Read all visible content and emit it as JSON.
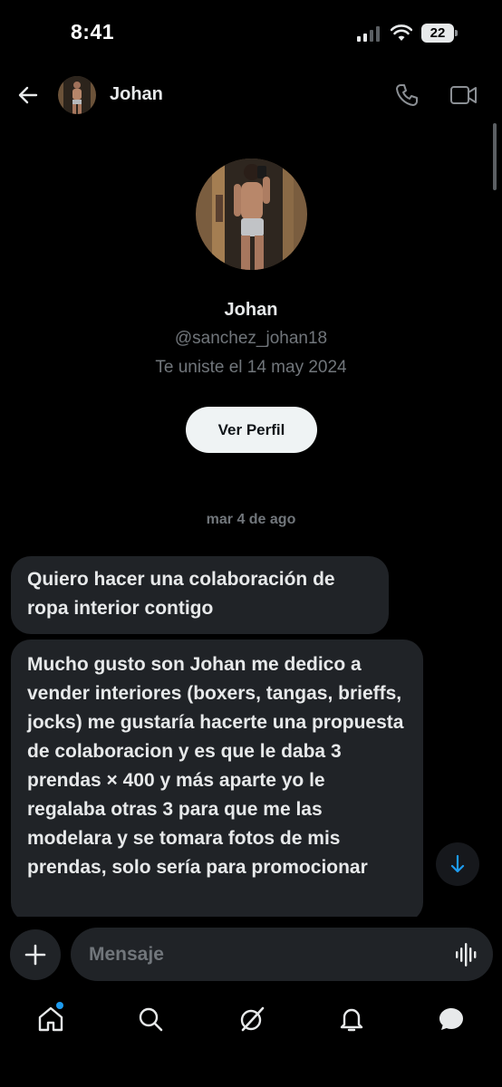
{
  "status_bar": {
    "time": "8:41",
    "battery": "22"
  },
  "header": {
    "name": "Johan",
    "icons": [
      "back-arrow-icon",
      "phone-icon",
      "video-camera-icon"
    ]
  },
  "profile": {
    "name": "Johan",
    "handle": "@sanchez_johan18",
    "joined": "Te uniste el 14 may 2024",
    "view_profile_label": "Ver Perfil"
  },
  "conversation": {
    "date_separator": "mar 4 de ago",
    "messages": [
      {
        "text": "Quiero hacer una colaboración de ropa interior contigo"
      },
      {
        "text": "Mucho gusto son Johan me dedico  a vender interiores (boxers, tangas, brieffs, jocks) me gustaría hacerte una propuesta de colaboracion y es que le daba 3 prendas × 400 y más aparte yo le regalaba otras 3 para que me las modelara y se tomara fotos de mis prendas, solo sería para promocionar"
      }
    ]
  },
  "composer": {
    "placeholder": "Mensaje"
  },
  "bottom_nav": {
    "items": [
      "home-icon",
      "search-icon",
      "grok-icon",
      "notifications-bell-icon",
      "messages-icon"
    ]
  },
  "colors": {
    "background": "#000000",
    "bubble": "#202327",
    "text": "#e7e9ea",
    "muted": "#71767b",
    "accent": "#1d9bf0"
  }
}
